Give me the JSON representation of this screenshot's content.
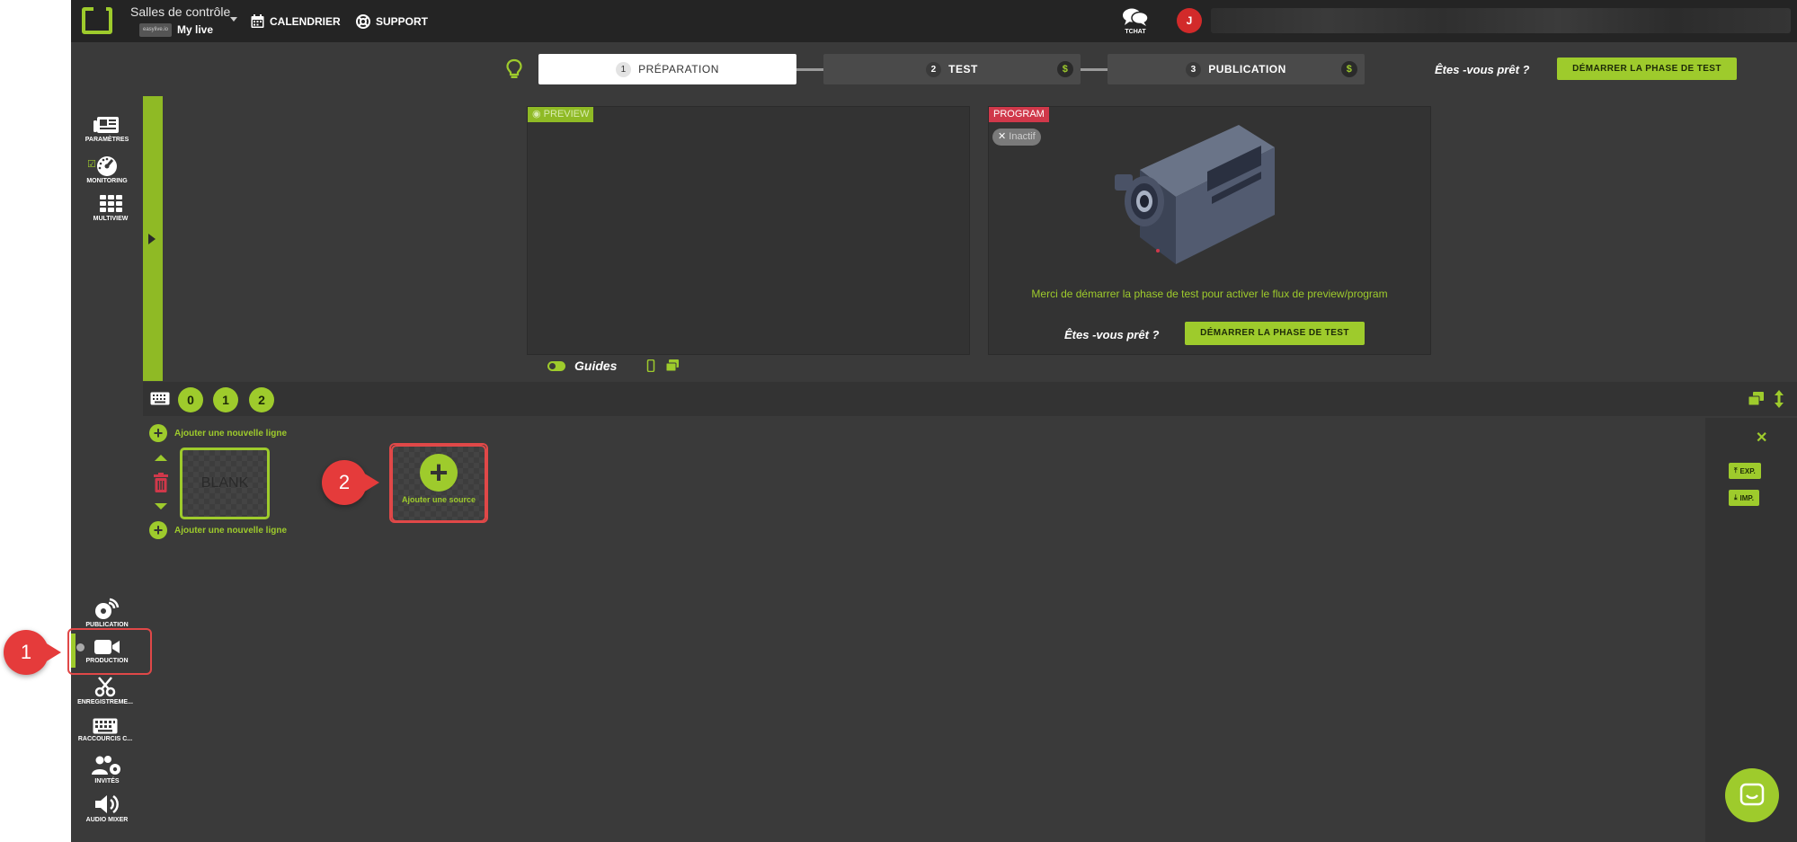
{
  "header": {
    "room_title": "Salles de contrôle",
    "room_chip": "easylive.io",
    "room_name": "My live",
    "nav": [
      {
        "label": "CALENDRIER",
        "icon": "calendar-icon"
      },
      {
        "label": "SUPPORT",
        "icon": "lifebuoy-icon"
      }
    ],
    "chat_label": "TCHAT",
    "avatar_initial": "J"
  },
  "steps": {
    "items": [
      {
        "num": "1",
        "label": "PRÉPARATION"
      },
      {
        "num": "2",
        "label": "TEST"
      },
      {
        "num": "3",
        "label": "PUBLICATION"
      }
    ],
    "dollar": "$",
    "ready_text": "Êtes -vous prêt ?",
    "start_button": "DÉMARRER LA PHASE DE TEST"
  },
  "sidebar_top": [
    {
      "label": "PARAMÈTRES",
      "icon": "newspaper-icon"
    },
    {
      "label": "MONITORING",
      "icon": "gauge-icon"
    },
    {
      "label": "MULTIVIEW",
      "icon": "grid-icon"
    }
  ],
  "sidebar_bottom": [
    {
      "label": "PUBLICATION",
      "icon": "broadcast-icon"
    },
    {
      "label": "PRODUCTION",
      "icon": "video-camera-icon"
    },
    {
      "label": "ENREGISTREME...",
      "icon": "scissors-icon"
    },
    {
      "label": "RACCOURCIS C...",
      "icon": "keyboard-icon"
    },
    {
      "label": "INVITÉS",
      "icon": "users-gear-icon"
    },
    {
      "label": "AUDIO MIXER",
      "icon": "speaker-icon"
    }
  ],
  "preview": {
    "tag": "PREVIEW"
  },
  "program": {
    "tag": "PROGRAM",
    "status": "Inactif",
    "message": "Merci de démarrer la phase de test pour activer le flux de preview/program",
    "ready_text": "Êtes -vous prêt ?",
    "start_button": "DÉMARRER LA PHASE DE TEST"
  },
  "guides_label": "Guides",
  "layers": [
    "0",
    "1",
    "2"
  ],
  "rows": {
    "add_line": "Ajouter une nouvelle ligne",
    "blank_label": "BLANK",
    "add_source": "Ajouter une source"
  },
  "right_panel": {
    "export": "EXP.",
    "import": "IMP."
  },
  "callouts": [
    "1",
    "2"
  ],
  "colors": {
    "accent": "#9ecb2c",
    "program_red": "#d0384a",
    "callout_red": "#e53b3b"
  }
}
